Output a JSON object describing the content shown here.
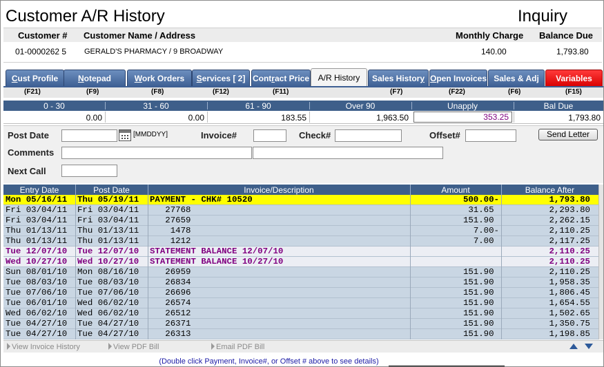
{
  "header": {
    "title": "Customer A/R History",
    "mode": "Inquiry"
  },
  "customer": {
    "number_label": "Customer #",
    "name_label": "Customer Name / Address",
    "monthly_label": "Monthly Charge",
    "balance_label": "Balance Due",
    "number": "01-0000262 5",
    "name": "GERALD'S PHARMACY  /  9 BROADWAY",
    "monthly": "140.00",
    "balance": "1,793.80"
  },
  "tabs": [
    {
      "pre": "",
      "u": "C",
      "post": "ust Profile",
      "fkey": "(F21)",
      "active": false,
      "red": false
    },
    {
      "pre": "",
      "u": "N",
      "post": "otepad",
      "fkey": "(F9)",
      "active": false,
      "red": false
    },
    {
      "pre": "",
      "u": "W",
      "post": "ork Orders",
      "fkey": "(F8)",
      "active": false,
      "red": false
    },
    {
      "pre": "",
      "u": "S",
      "post": "ervices [   2]",
      "fkey": "(F12)",
      "active": false,
      "red": false
    },
    {
      "pre": "Cont",
      "u": "r",
      "post": "act Price",
      "fkey": "(F11)",
      "active": false,
      "red": false
    },
    {
      "pre": "A/R History",
      "u": "",
      "post": "",
      "fkey": "",
      "active": true,
      "red": false
    },
    {
      "pre": "Sales Histor",
      "u": "y",
      "post": "",
      "fkey": "(F7)",
      "active": false,
      "red": false
    },
    {
      "pre": "",
      "u": "O",
      "post": "pen Invoices",
      "fkey": "(F22)",
      "active": false,
      "red": false
    },
    {
      "pre": "Sales & Ad",
      "u": "j",
      "post": "",
      "fkey": "(F6)",
      "active": false,
      "red": false
    },
    {
      "pre": "Variables",
      "u": "",
      "post": "",
      "fkey": "(F15)",
      "active": false,
      "red": true
    }
  ],
  "aging": {
    "headers": [
      "0 - 30",
      "31 - 60",
      "61 - 90",
      "Over 90",
      "Unapply",
      "Bal Due"
    ],
    "values": [
      "0.00",
      "0.00",
      "183.55",
      "1,963.50",
      "353.25",
      "1,793.80"
    ]
  },
  "form": {
    "post_date_label": "Post Date",
    "date_format": "[MMDDYY]",
    "invoice_label": "Invoice#",
    "check_label": "Check#",
    "offset_label": "Offset#",
    "send_letter": "Send Letter",
    "comments_label": "Comments",
    "next_call_label": "Next Call",
    "post_date_value": "",
    "invoice_value": "",
    "check_value": "",
    "offset_value": "",
    "comments1_value": "",
    "comments2_value": "",
    "next_call_value": ""
  },
  "grid": {
    "columns": [
      "Entry Date",
      "Post Date",
      "Invoice/Description",
      "Amount",
      "Balance After"
    ],
    "rows": [
      {
        "entry": "Mon 05/16/11",
        "post": "Thu 05/19/11",
        "desc": "PAYMENT - CHK# 10520",
        "amount": "500.00-",
        "balance": "1,793.80",
        "style": "selected"
      },
      {
        "entry": "Fri 03/04/11",
        "post": "Fri 03/04/11",
        "desc": "   27768",
        "amount": "31.65 ",
        "balance": "2,293.80",
        "style": "normal"
      },
      {
        "entry": "Fri 03/04/11",
        "post": "Fri 03/04/11",
        "desc": "   27659",
        "amount": "151.90 ",
        "balance": "2,262.15",
        "style": "normal"
      },
      {
        "entry": "Thu 01/13/11",
        "post": "Thu 01/13/11",
        "desc": "    1478",
        "amount": "7.00-",
        "balance": "2,110.25",
        "style": "normal"
      },
      {
        "entry": "Thu 01/13/11",
        "post": "Thu 01/13/11",
        "desc": "    1212",
        "amount": "7.00 ",
        "balance": "2,117.25",
        "style": "normal"
      },
      {
        "entry": "Tue 12/07/10",
        "post": "Tue 12/07/10",
        "desc": "STATEMENT BALANCE 12/07/10",
        "amount": "",
        "balance": "2,110.25",
        "style": "statement"
      },
      {
        "entry": "Wed 10/27/10",
        "post": "Wed 10/27/10",
        "desc": "STATEMENT BALANCE 10/27/10",
        "amount": "",
        "balance": "2,110.25",
        "style": "statement"
      },
      {
        "entry": "Sun 08/01/10",
        "post": "Mon 08/16/10",
        "desc": "   26959",
        "amount": "151.90 ",
        "balance": "2,110.25",
        "style": "normal"
      },
      {
        "entry": "Tue 08/03/10",
        "post": "Tue 08/03/10",
        "desc": "   26834",
        "amount": "151.90 ",
        "balance": "1,958.35",
        "style": "normal"
      },
      {
        "entry": "Tue 07/06/10",
        "post": "Tue 07/06/10",
        "desc": "   26696",
        "amount": "151.90 ",
        "balance": "1,806.45",
        "style": "normal"
      },
      {
        "entry": "Tue 06/01/10",
        "post": "Wed 06/02/10",
        "desc": "   26574",
        "amount": "151.90 ",
        "balance": "1,654.55",
        "style": "normal"
      },
      {
        "entry": "Wed 06/02/10",
        "post": "Wed 06/02/10",
        "desc": "   26512",
        "amount": "151.90 ",
        "balance": "1,502.65",
        "style": "normal"
      },
      {
        "entry": "Tue 04/27/10",
        "post": "Tue 04/27/10",
        "desc": "   26371",
        "amount": "151.90 ",
        "balance": "1,350.75",
        "style": "normal"
      },
      {
        "entry": "Tue 04/27/10",
        "post": "Tue 04/27/10",
        "desc": "   26313",
        "amount": "151.90 ",
        "balance": "1,198.85",
        "style": "normal"
      }
    ]
  },
  "bottom": {
    "view_invoice_history": "View Invoice History",
    "view_pdf_bill": "View PDF Bill",
    "email_pdf_bill": "Email PDF Bill",
    "hint": "(Double click Payment, Invoice#, or Offset # above to see details)"
  },
  "colors": {
    "header_blue": "#3e5f8a",
    "tab_blue": "#3d5f93",
    "tab_red": "#e00000",
    "selected_row": "#ffff00",
    "statement_row_bg": "#eceef4",
    "statement_text": "#800080",
    "grid_row_bg": "#c9d6e3"
  }
}
